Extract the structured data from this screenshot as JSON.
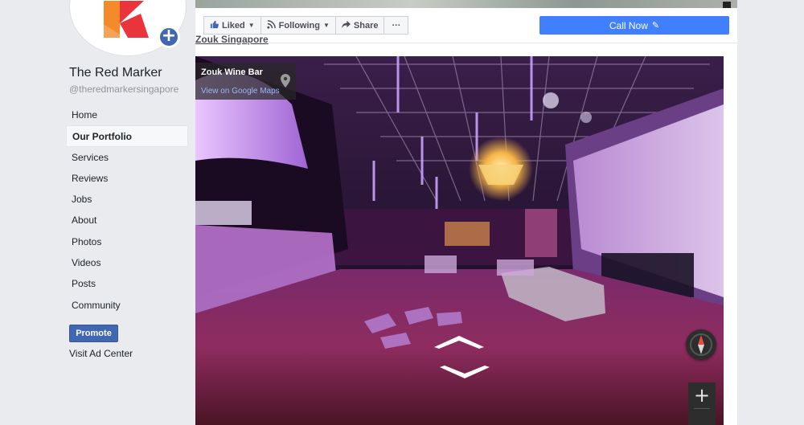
{
  "page": {
    "name": "The Red Marker",
    "handle": "@theredmarkersingapore"
  },
  "nav": {
    "items": [
      {
        "label": "Home"
      },
      {
        "label": "Our Portfolio",
        "active": true
      },
      {
        "label": "Services"
      },
      {
        "label": "Reviews"
      },
      {
        "label": "Jobs"
      },
      {
        "label": "About"
      },
      {
        "label": "Photos"
      },
      {
        "label": "Videos"
      },
      {
        "label": "Posts"
      },
      {
        "label": "Community"
      }
    ]
  },
  "sidebar": {
    "promote_label": "Promote",
    "ad_center_label": "Visit Ad Center"
  },
  "actions": {
    "liked_label": "Liked",
    "following_label": "Following",
    "share_label": "Share",
    "more_label": "···",
    "call_now_label": "Call Now"
  },
  "content": {
    "cut_link": "Zouk Singapore"
  },
  "streetview": {
    "place_name": "Zouk Wine Bar",
    "maps_link": "View on Google Maps",
    "zoom_in": "+"
  },
  "colors": {
    "brand_blue": "#4267b2",
    "call_blue": "#4080ff",
    "logo_red": "#e8343a",
    "logo_orange": "#f58a2a"
  },
  "icons": {
    "liked": "thumbs-up-icon",
    "following": "rss-icon",
    "share": "share-arrow-icon",
    "call_edit": "pencil-icon",
    "location": "map-pin-icon",
    "compass": "compass-icon"
  }
}
